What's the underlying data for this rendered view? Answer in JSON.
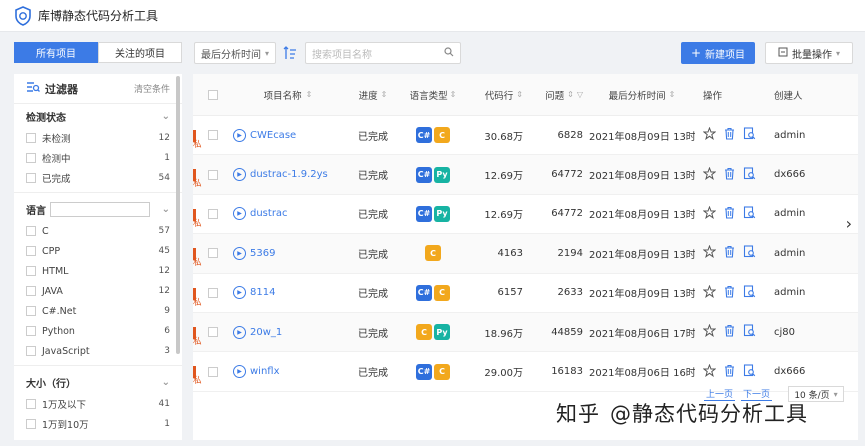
{
  "app": {
    "title": "库博静态代码分析工具"
  },
  "toolbar": {
    "tabs": [
      {
        "label": "所有项目",
        "active": true
      },
      {
        "label": "关注的项目",
        "active": false
      }
    ],
    "sort_select": "最后分析时间",
    "search_placeholder": "搜索项目名称",
    "new_button": "新建项目",
    "batch_button": "批量操作"
  },
  "sidebar": {
    "title": "过滤器",
    "clear": "清空条件",
    "sections": [
      {
        "title": "检测状态",
        "options": [
          {
            "label": "未检测",
            "count": "12"
          },
          {
            "label": "检测中",
            "count": "1"
          },
          {
            "label": "已完成",
            "count": "54"
          }
        ]
      },
      {
        "title": "语言",
        "options": [
          {
            "label": "C",
            "count": "57"
          },
          {
            "label": "CPP",
            "count": "45"
          },
          {
            "label": "HTML",
            "count": "12"
          },
          {
            "label": "JAVA",
            "count": "12"
          },
          {
            "label": "C#.Net",
            "count": "9"
          },
          {
            "label": "Python",
            "count": "6"
          },
          {
            "label": "JavaScript",
            "count": "3"
          }
        ]
      },
      {
        "title": "大小（行）",
        "options": [
          {
            "label": "1万及以下",
            "count": "41"
          },
          {
            "label": "1万到10万",
            "count": "1"
          }
        ]
      }
    ]
  },
  "table": {
    "headers": [
      "项目名称",
      "进度",
      "语言类型",
      "代码行",
      "问题",
      "最后分析时间",
      "操作",
      "创建人"
    ],
    "rows": [
      {
        "name": "CWEcase",
        "progress": "已完成",
        "langs": [
          "C#",
          "C"
        ],
        "loc": "30.68万",
        "issues": "6828",
        "time": "2021年08月09日 13时...",
        "user": "admin",
        "private": true
      },
      {
        "name": "dustrac-1.9.2ys",
        "progress": "已完成",
        "langs": [
          "C#",
          "Py"
        ],
        "loc": "12.69万",
        "issues": "64772",
        "time": "2021年08月09日 13时...",
        "user": "dx666",
        "private": true
      },
      {
        "name": "dustrac",
        "progress": "已完成",
        "langs": [
          "C#",
          "Py"
        ],
        "loc": "12.69万",
        "issues": "64772",
        "time": "2021年08月09日 13时...",
        "user": "admin",
        "private": true
      },
      {
        "name": "5369",
        "progress": "已完成",
        "langs": [
          "C"
        ],
        "loc": "4163",
        "issues": "2194",
        "time": "2021年08月09日 13时...",
        "user": "admin",
        "private": true
      },
      {
        "name": "8114",
        "progress": "已完成",
        "langs": [
          "C#",
          "C"
        ],
        "loc": "6157",
        "issues": "2633",
        "time": "2021年08月09日 13时...",
        "user": "admin",
        "private": true
      },
      {
        "name": "20w_1",
        "progress": "已完成",
        "langs": [
          "C",
          "Py"
        ],
        "loc": "18.96万",
        "issues": "44859",
        "time": "2021年08月06日 17时...",
        "user": "cj80",
        "private": true
      },
      {
        "name": "winflx",
        "progress": "已完成",
        "langs": [
          "C#",
          "C"
        ],
        "loc": "29.00万",
        "issues": "16183",
        "time": "2021年08月06日 16时...",
        "user": "dx666",
        "private": true
      }
    ],
    "private_label": "私"
  },
  "pager": {
    "prev": "上一页",
    "next": "下一页",
    "size": "10 条/页"
  },
  "watermark": {
    "site": "知乎",
    "author": "@静态代码分析工具"
  },
  "colors": {
    "accent": "#3c7be6",
    "private": "#e0561e",
    "lang_c": "#f2a81d",
    "lang_cs": "#2f6fdc",
    "lang_py": "#17b3a3"
  }
}
